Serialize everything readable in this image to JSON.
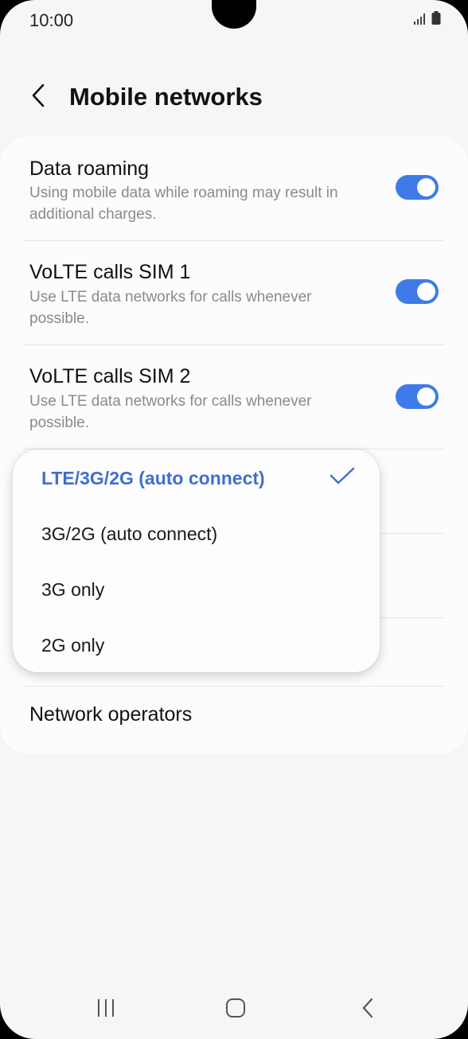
{
  "status": {
    "time": "10:00"
  },
  "header": {
    "title": "Mobile networks"
  },
  "settings": [
    {
      "title": "Data roaming",
      "subtitle": "Using mobile data while roaming may result in additional charges.",
      "enabled": true
    },
    {
      "title": "VoLTE calls SIM 1",
      "subtitle": "Use LTE data networks for calls whenever possible.",
      "enabled": true
    },
    {
      "title": "VoLTE calls SIM 2",
      "subtitle": "Use LTE data networks for calls whenever possible.",
      "enabled": true
    }
  ],
  "network_operators_label": "Network operators",
  "network_mode_menu": {
    "options": [
      "LTE/3G/2G (auto connect)",
      "3G/2G (auto connect)",
      "3G only",
      "2G only"
    ],
    "selected": "LTE/3G/2G (auto connect)"
  },
  "colors": {
    "accent": "#3e7be8",
    "selected_text": "#3e6fd0",
    "background": "#f6f6f8"
  },
  "icons": {
    "back": "chevron-left-icon",
    "signal": "signal-icon",
    "battery": "battery-icon",
    "check": "checkmark-icon",
    "nav_recents": "recents-icon",
    "nav_home": "home-icon",
    "nav_back": "back-icon"
  }
}
